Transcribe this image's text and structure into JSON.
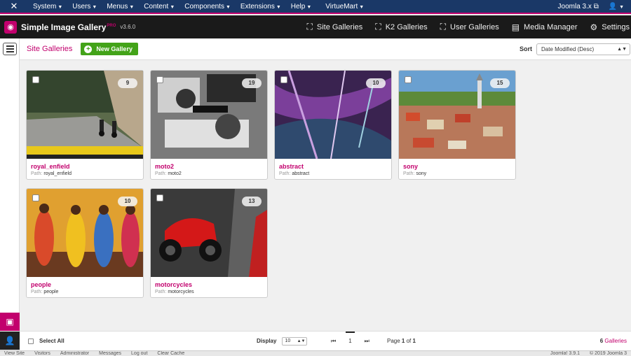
{
  "topnav": {
    "items": [
      "System",
      "Users",
      "Menus",
      "Content",
      "Components",
      "Extensions",
      "Help",
      "VirtueMart"
    ],
    "site_link": "Joomla 3.x"
  },
  "app": {
    "title": "Simple Image Gallery",
    "edition": "PRO",
    "version": "v3.6.0",
    "nav": [
      "Site Galleries",
      "K2 Galleries",
      "User Galleries",
      "Media Manager",
      "Settings"
    ]
  },
  "subheader": {
    "title": "Site Galleries",
    "new_button": "New Gallery",
    "sort_label": "Sort",
    "sort_value": "Date Modified (Desc)"
  },
  "galleries": [
    {
      "name": "royal_enfield",
      "path_label": "Path:",
      "path": "royal_enfield",
      "count": "9"
    },
    {
      "name": "moto2",
      "path_label": "Path:",
      "path": "moto2",
      "count": "19"
    },
    {
      "name": "abstract",
      "path_label": "Path:",
      "path": "abstract",
      "count": "10"
    },
    {
      "name": "sony",
      "path_label": "Path:",
      "path": "sony",
      "count": "15"
    },
    {
      "name": "people",
      "path_label": "Path:",
      "path": "people",
      "count": "10"
    },
    {
      "name": "motorcycles",
      "path_label": "Path:",
      "path": "motorcycles",
      "count": "13"
    }
  ],
  "footer": {
    "select_all": "Select All",
    "display_label": "Display",
    "display_value": "10",
    "current_page": "1",
    "page_prefix": "Page",
    "page_num": "1",
    "page_of": "of",
    "page_total": "1",
    "gallery_count": "6",
    "gallery_label": "Galleries"
  },
  "statusbar": {
    "left": [
      "View Site",
      "Visitors",
      "Administrator",
      "Messages",
      "Log out",
      "Clear Cache"
    ],
    "right": [
      "Joomla! 3.9.1",
      "© 2019 Joomla 3"
    ]
  },
  "colors": {
    "accent": "#c2006d",
    "nav": "#1a3867",
    "green": "#43a319"
  }
}
